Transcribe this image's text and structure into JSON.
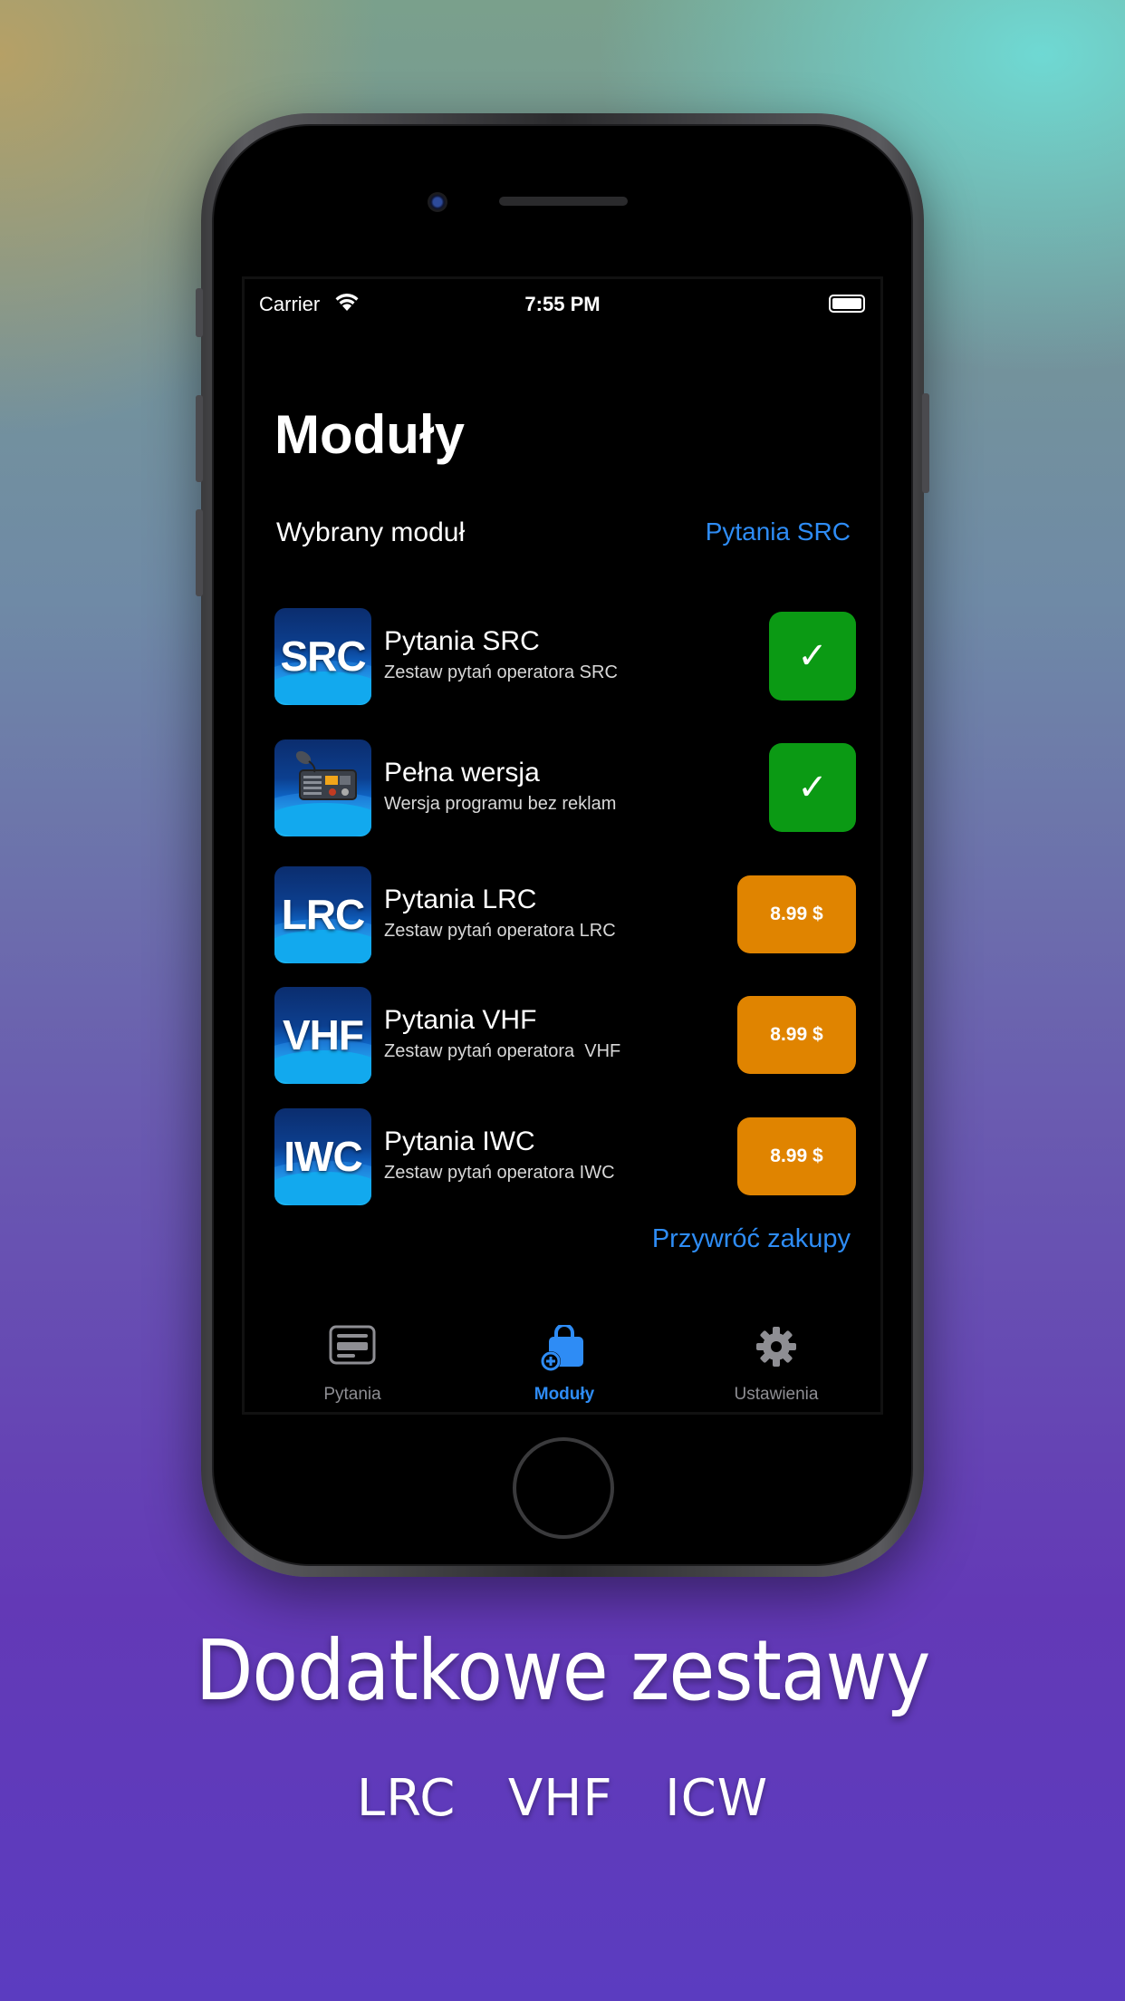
{
  "status_bar": {
    "carrier": "Carrier",
    "time": "7:55 PM"
  },
  "header": {
    "title": "Moduły"
  },
  "selected_module": {
    "label": "Wybrany moduł",
    "value": "Pytania SRC"
  },
  "modules": [
    {
      "icon_text": "SRC",
      "name": "Pytania SRC",
      "description": "Zestaw pytań operatora SRC",
      "status": "owned",
      "button": "✓"
    },
    {
      "icon_text": "",
      "icon": "radio-icon",
      "name": "Pełna wersja",
      "description": "Wersja programu bez reklam",
      "status": "owned",
      "button": "✓"
    },
    {
      "icon_text": "LRC",
      "name": "Pytania LRC",
      "description": "Zestaw pytań operatora LRC",
      "status": "price",
      "button": "8.99 $"
    },
    {
      "icon_text": "VHF",
      "name": "Pytania VHF",
      "description": "Zestaw pytań operatora  VHF",
      "status": "price",
      "button": "8.99 $"
    },
    {
      "icon_text": "IWC",
      "name": "Pytania IWC",
      "description": "Zestaw pytań operatora IWC",
      "status": "price",
      "button": "8.99 $"
    }
  ],
  "restore": {
    "label": "Przywróć zakupy"
  },
  "tabs": [
    {
      "label": "Pytania",
      "icon": "questions-icon",
      "active": false
    },
    {
      "label": "Moduły",
      "icon": "shopping-bag-icon",
      "active": true
    },
    {
      "label": "Ustawienia",
      "icon": "gear-icon",
      "active": false
    }
  ],
  "caption": {
    "title": "Dodatkowe zestawy",
    "subtitle": "LRC  VHF  ICW"
  },
  "colors": {
    "accent": "#2e8cf5",
    "owned": "#0b9a14",
    "price": "#e08400",
    "screen_bg": "#000000"
  }
}
